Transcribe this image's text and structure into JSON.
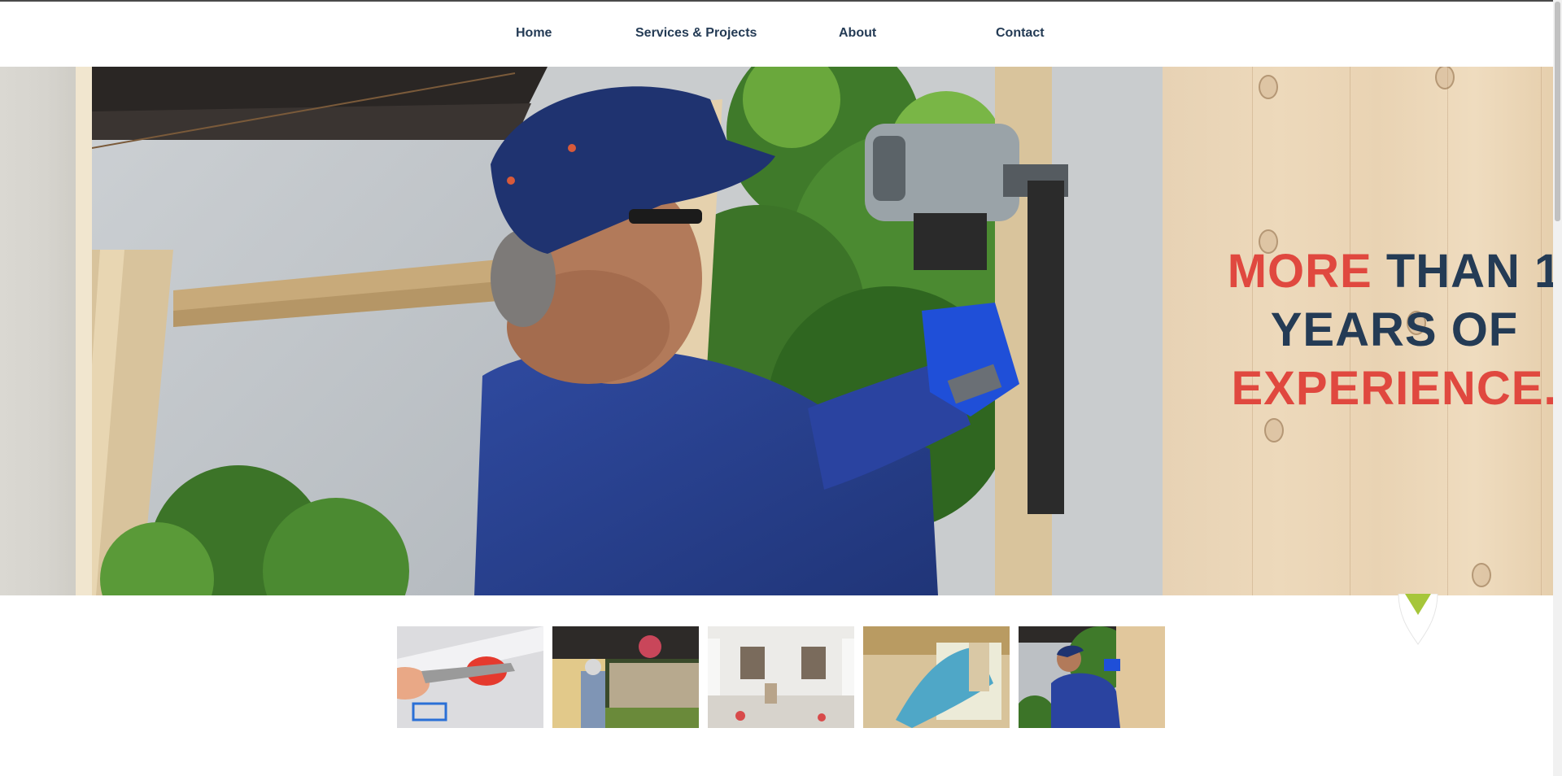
{
  "nav": {
    "items": [
      {
        "label": "Home"
      },
      {
        "label": "Services & Projects"
      },
      {
        "label": "About"
      },
      {
        "label": "Contact"
      }
    ]
  },
  "hero": {
    "headline": {
      "line1_red": "MORE",
      "line1_blue": " THAN 1",
      "line2_blue": "YEARS OF",
      "line3_red": "EXPERIENCE."
    }
  },
  "gallery": {
    "thumbnails": [
      {
        "icon": "painting-trim-photo"
      },
      {
        "icon": "fence-building-photo"
      },
      {
        "icon": "room-renovation-photo"
      },
      {
        "icon": "wall-brushing-photo"
      },
      {
        "icon": "fence-nailing-photo"
      }
    ]
  },
  "colors": {
    "nav_text": "#243b55",
    "headline_red": "#e0483f",
    "headline_blue": "#243b55",
    "marker_green": "#a6c63a"
  }
}
